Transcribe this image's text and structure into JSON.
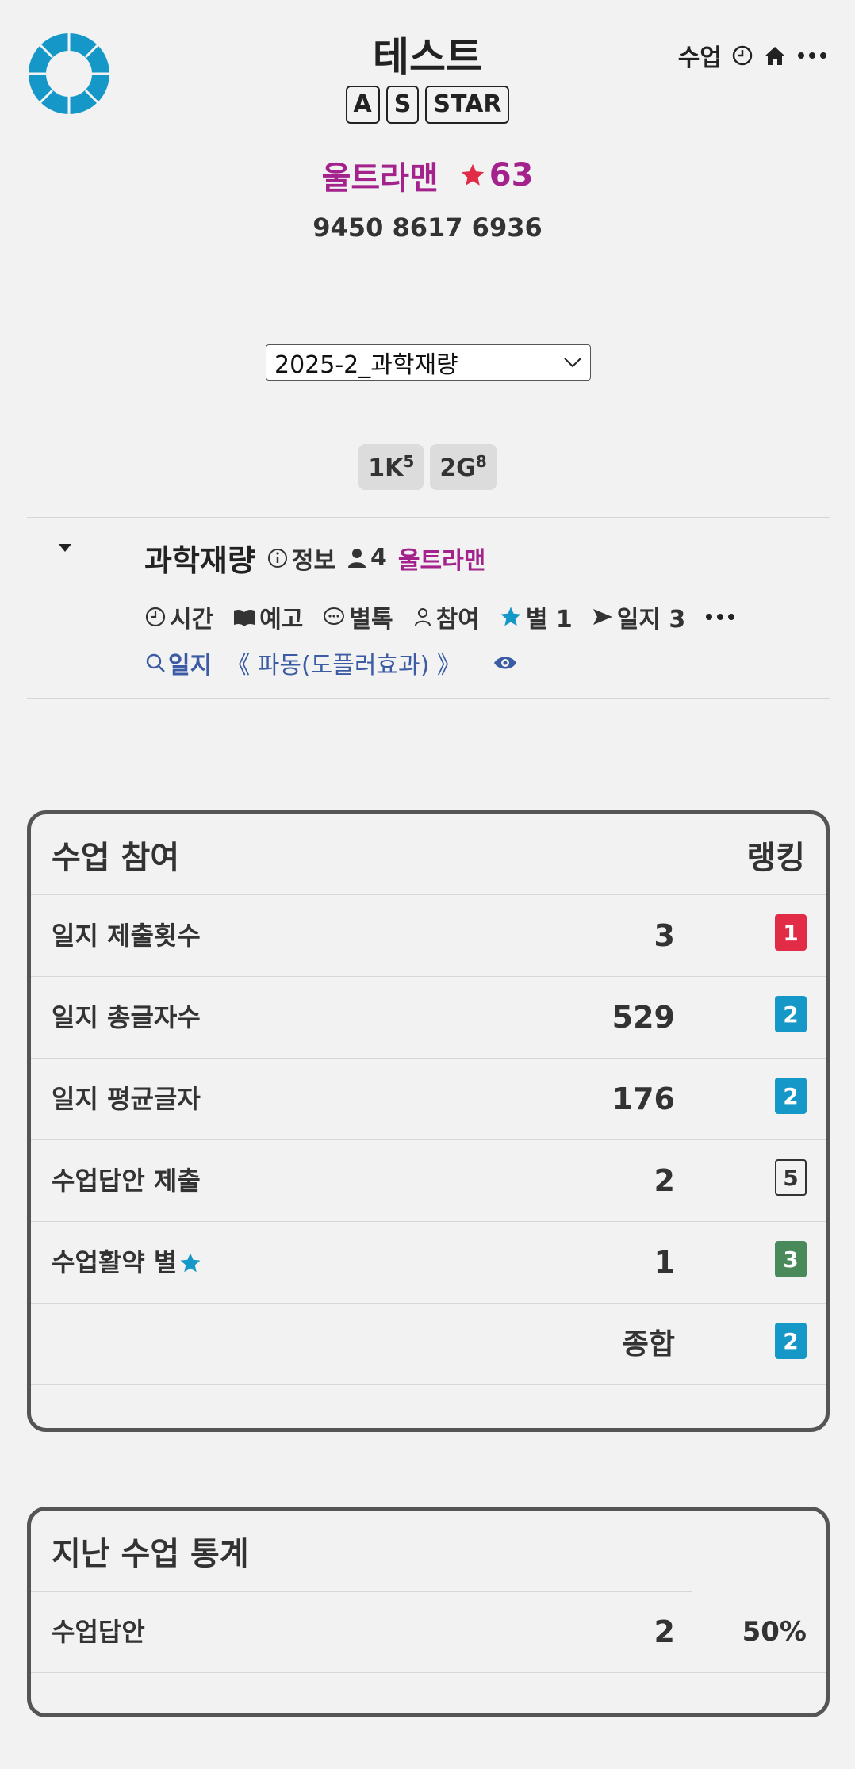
{
  "header": {
    "title": "테스트",
    "nav_label": "수업",
    "badges": [
      "A",
      "S",
      "STAR"
    ],
    "user_name": "울트라맨",
    "star_count": "63",
    "phone": "9450 8617 6936"
  },
  "selector": {
    "selected": "2025-2_과학재량"
  },
  "chips": [
    {
      "base": "1K",
      "sup": "5"
    },
    {
      "base": "2G",
      "sup": "8"
    }
  ],
  "course": {
    "name": "과학재량",
    "info_label": "정보",
    "members": "4",
    "teacher": "울트라맨",
    "actions": {
      "time": "시간",
      "preview": "예고",
      "chat": "별톡",
      "participate": "참여",
      "star": "별 1",
      "journal": "일지 3"
    },
    "journal_search_label": "일지",
    "journal_topic": "《 파동(도플러효과) 》"
  },
  "participation": {
    "title": "수업 참여",
    "rank_header": "랭킹",
    "rows": [
      {
        "label": "일지 제출횟수",
        "value": "3",
        "rank": "1"
      },
      {
        "label": "일지 총글자수",
        "value": "529",
        "rank": "2"
      },
      {
        "label": "일지 평균글자",
        "value": "176",
        "rank": "2"
      },
      {
        "label": "수업답안 제출",
        "value": "2",
        "rank": "5"
      },
      {
        "label": "수업활약 별",
        "value": "1",
        "rank": "3"
      }
    ],
    "total_label": "종합",
    "total_rank": "2"
  },
  "stats": {
    "title": "지난 수업 통계",
    "row_label": "수업답안",
    "row_value": "2",
    "row_pct": "50%"
  },
  "colors": {
    "purple": "#a3228c",
    "blue": "#1598c8",
    "red": "#e22c47",
    "green": "#4a8a5a",
    "link": "#3b5ba5"
  }
}
